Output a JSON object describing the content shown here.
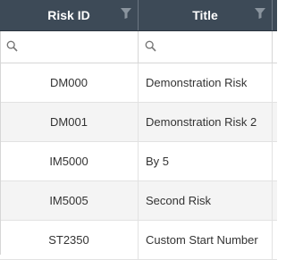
{
  "columns": [
    {
      "label": "Risk ID"
    },
    {
      "label": "Title"
    }
  ],
  "filters": [
    {
      "value": "",
      "placeholder": ""
    },
    {
      "value": "",
      "placeholder": ""
    }
  ],
  "rows": [
    {
      "risk_id": "DM000",
      "title": "Demonstration Risk"
    },
    {
      "risk_id": "DM001",
      "title": "Demonstration Risk 2"
    },
    {
      "risk_id": "IM5000",
      "title": "By 5"
    },
    {
      "risk_id": "IM5005",
      "title": "Second Risk"
    },
    {
      "risk_id": "ST2350",
      "title": "Custom Start Number"
    }
  ],
  "colors": {
    "header_bg": "#3d4a57",
    "header_text": "#ffffff",
    "alt_row_bg": "#f4f4f4",
    "filter_icon": "#8a949e"
  },
  "icons": [
    "filter-icon",
    "search-icon"
  ]
}
